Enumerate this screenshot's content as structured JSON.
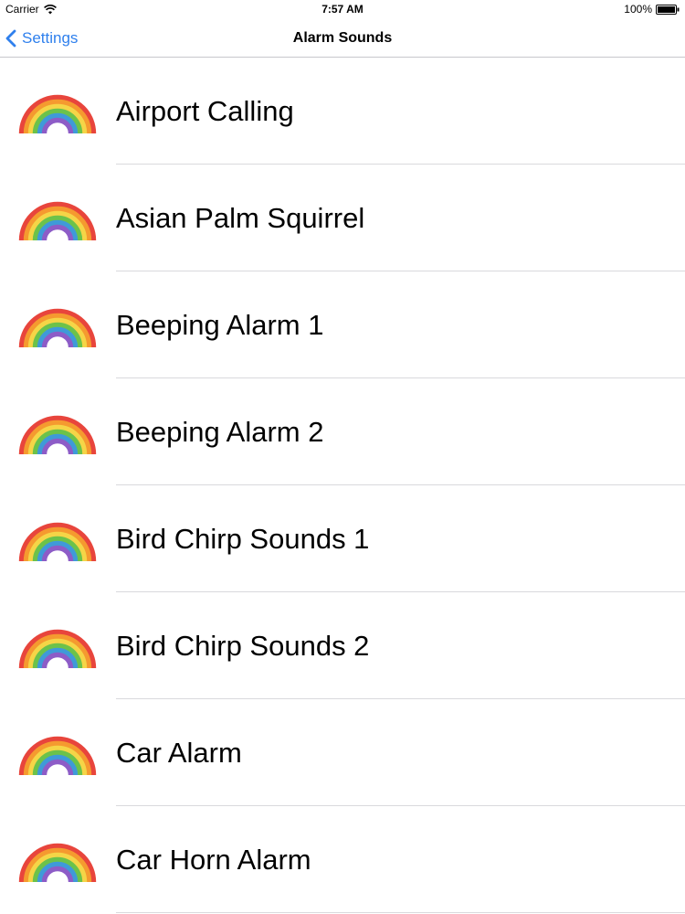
{
  "status_bar": {
    "carrier": "Carrier",
    "time": "7:57 AM",
    "battery": "100%"
  },
  "nav": {
    "back_label": "Settings",
    "title": "Alarm Sounds"
  },
  "icons": {
    "row_icon": "rainbow-icon",
    "back_icon": "chevron-left-icon"
  },
  "colors": {
    "accent": "#2f80ed",
    "rainbow": [
      "#e8453c",
      "#f59a2f",
      "#f5d547",
      "#6cc24a",
      "#3f9ad8",
      "#8d5cc7"
    ]
  },
  "sounds": [
    {
      "name": "Airport Calling"
    },
    {
      "name": "Asian Palm Squirrel"
    },
    {
      "name": "Beeping Alarm 1"
    },
    {
      "name": "Beeping Alarm 2"
    },
    {
      "name": "Bird Chirp Sounds 1"
    },
    {
      "name": "Bird Chirp Sounds 2"
    },
    {
      "name": "Car Alarm"
    },
    {
      "name": "Car Horn Alarm"
    }
  ]
}
